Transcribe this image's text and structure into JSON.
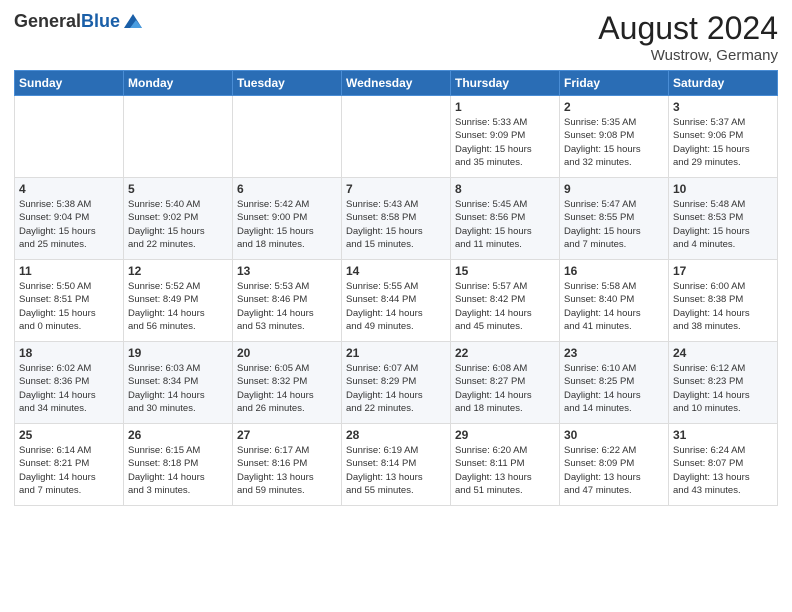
{
  "header": {
    "logo_general": "General",
    "logo_blue": "Blue",
    "main_title": "August 2024",
    "subtitle": "Wustrow, Germany"
  },
  "weekdays": [
    "Sunday",
    "Monday",
    "Tuesday",
    "Wednesday",
    "Thursday",
    "Friday",
    "Saturday"
  ],
  "weeks": [
    [
      {
        "day": "",
        "info": ""
      },
      {
        "day": "",
        "info": ""
      },
      {
        "day": "",
        "info": ""
      },
      {
        "day": "",
        "info": ""
      },
      {
        "day": "1",
        "info": "Sunrise: 5:33 AM\nSunset: 9:09 PM\nDaylight: 15 hours\nand 35 minutes."
      },
      {
        "day": "2",
        "info": "Sunrise: 5:35 AM\nSunset: 9:08 PM\nDaylight: 15 hours\nand 32 minutes."
      },
      {
        "day": "3",
        "info": "Sunrise: 5:37 AM\nSunset: 9:06 PM\nDaylight: 15 hours\nand 29 minutes."
      }
    ],
    [
      {
        "day": "4",
        "info": "Sunrise: 5:38 AM\nSunset: 9:04 PM\nDaylight: 15 hours\nand 25 minutes."
      },
      {
        "day": "5",
        "info": "Sunrise: 5:40 AM\nSunset: 9:02 PM\nDaylight: 15 hours\nand 22 minutes."
      },
      {
        "day": "6",
        "info": "Sunrise: 5:42 AM\nSunset: 9:00 PM\nDaylight: 15 hours\nand 18 minutes."
      },
      {
        "day": "7",
        "info": "Sunrise: 5:43 AM\nSunset: 8:58 PM\nDaylight: 15 hours\nand 15 minutes."
      },
      {
        "day": "8",
        "info": "Sunrise: 5:45 AM\nSunset: 8:56 PM\nDaylight: 15 hours\nand 11 minutes."
      },
      {
        "day": "9",
        "info": "Sunrise: 5:47 AM\nSunset: 8:55 PM\nDaylight: 15 hours\nand 7 minutes."
      },
      {
        "day": "10",
        "info": "Sunrise: 5:48 AM\nSunset: 8:53 PM\nDaylight: 15 hours\nand 4 minutes."
      }
    ],
    [
      {
        "day": "11",
        "info": "Sunrise: 5:50 AM\nSunset: 8:51 PM\nDaylight: 15 hours\nand 0 minutes."
      },
      {
        "day": "12",
        "info": "Sunrise: 5:52 AM\nSunset: 8:49 PM\nDaylight: 14 hours\nand 56 minutes."
      },
      {
        "day": "13",
        "info": "Sunrise: 5:53 AM\nSunset: 8:46 PM\nDaylight: 14 hours\nand 53 minutes."
      },
      {
        "day": "14",
        "info": "Sunrise: 5:55 AM\nSunset: 8:44 PM\nDaylight: 14 hours\nand 49 minutes."
      },
      {
        "day": "15",
        "info": "Sunrise: 5:57 AM\nSunset: 8:42 PM\nDaylight: 14 hours\nand 45 minutes."
      },
      {
        "day": "16",
        "info": "Sunrise: 5:58 AM\nSunset: 8:40 PM\nDaylight: 14 hours\nand 41 minutes."
      },
      {
        "day": "17",
        "info": "Sunrise: 6:00 AM\nSunset: 8:38 PM\nDaylight: 14 hours\nand 38 minutes."
      }
    ],
    [
      {
        "day": "18",
        "info": "Sunrise: 6:02 AM\nSunset: 8:36 PM\nDaylight: 14 hours\nand 34 minutes."
      },
      {
        "day": "19",
        "info": "Sunrise: 6:03 AM\nSunset: 8:34 PM\nDaylight: 14 hours\nand 30 minutes."
      },
      {
        "day": "20",
        "info": "Sunrise: 6:05 AM\nSunset: 8:32 PM\nDaylight: 14 hours\nand 26 minutes."
      },
      {
        "day": "21",
        "info": "Sunrise: 6:07 AM\nSunset: 8:29 PM\nDaylight: 14 hours\nand 22 minutes."
      },
      {
        "day": "22",
        "info": "Sunrise: 6:08 AM\nSunset: 8:27 PM\nDaylight: 14 hours\nand 18 minutes."
      },
      {
        "day": "23",
        "info": "Sunrise: 6:10 AM\nSunset: 8:25 PM\nDaylight: 14 hours\nand 14 minutes."
      },
      {
        "day": "24",
        "info": "Sunrise: 6:12 AM\nSunset: 8:23 PM\nDaylight: 14 hours\nand 10 minutes."
      }
    ],
    [
      {
        "day": "25",
        "info": "Sunrise: 6:14 AM\nSunset: 8:21 PM\nDaylight: 14 hours\nand 7 minutes."
      },
      {
        "day": "26",
        "info": "Sunrise: 6:15 AM\nSunset: 8:18 PM\nDaylight: 14 hours\nand 3 minutes."
      },
      {
        "day": "27",
        "info": "Sunrise: 6:17 AM\nSunset: 8:16 PM\nDaylight: 13 hours\nand 59 minutes."
      },
      {
        "day": "28",
        "info": "Sunrise: 6:19 AM\nSunset: 8:14 PM\nDaylight: 13 hours\nand 55 minutes."
      },
      {
        "day": "29",
        "info": "Sunrise: 6:20 AM\nSunset: 8:11 PM\nDaylight: 13 hours\nand 51 minutes."
      },
      {
        "day": "30",
        "info": "Sunrise: 6:22 AM\nSunset: 8:09 PM\nDaylight: 13 hours\nand 47 minutes."
      },
      {
        "day": "31",
        "info": "Sunrise: 6:24 AM\nSunset: 8:07 PM\nDaylight: 13 hours\nand 43 minutes."
      }
    ]
  ]
}
